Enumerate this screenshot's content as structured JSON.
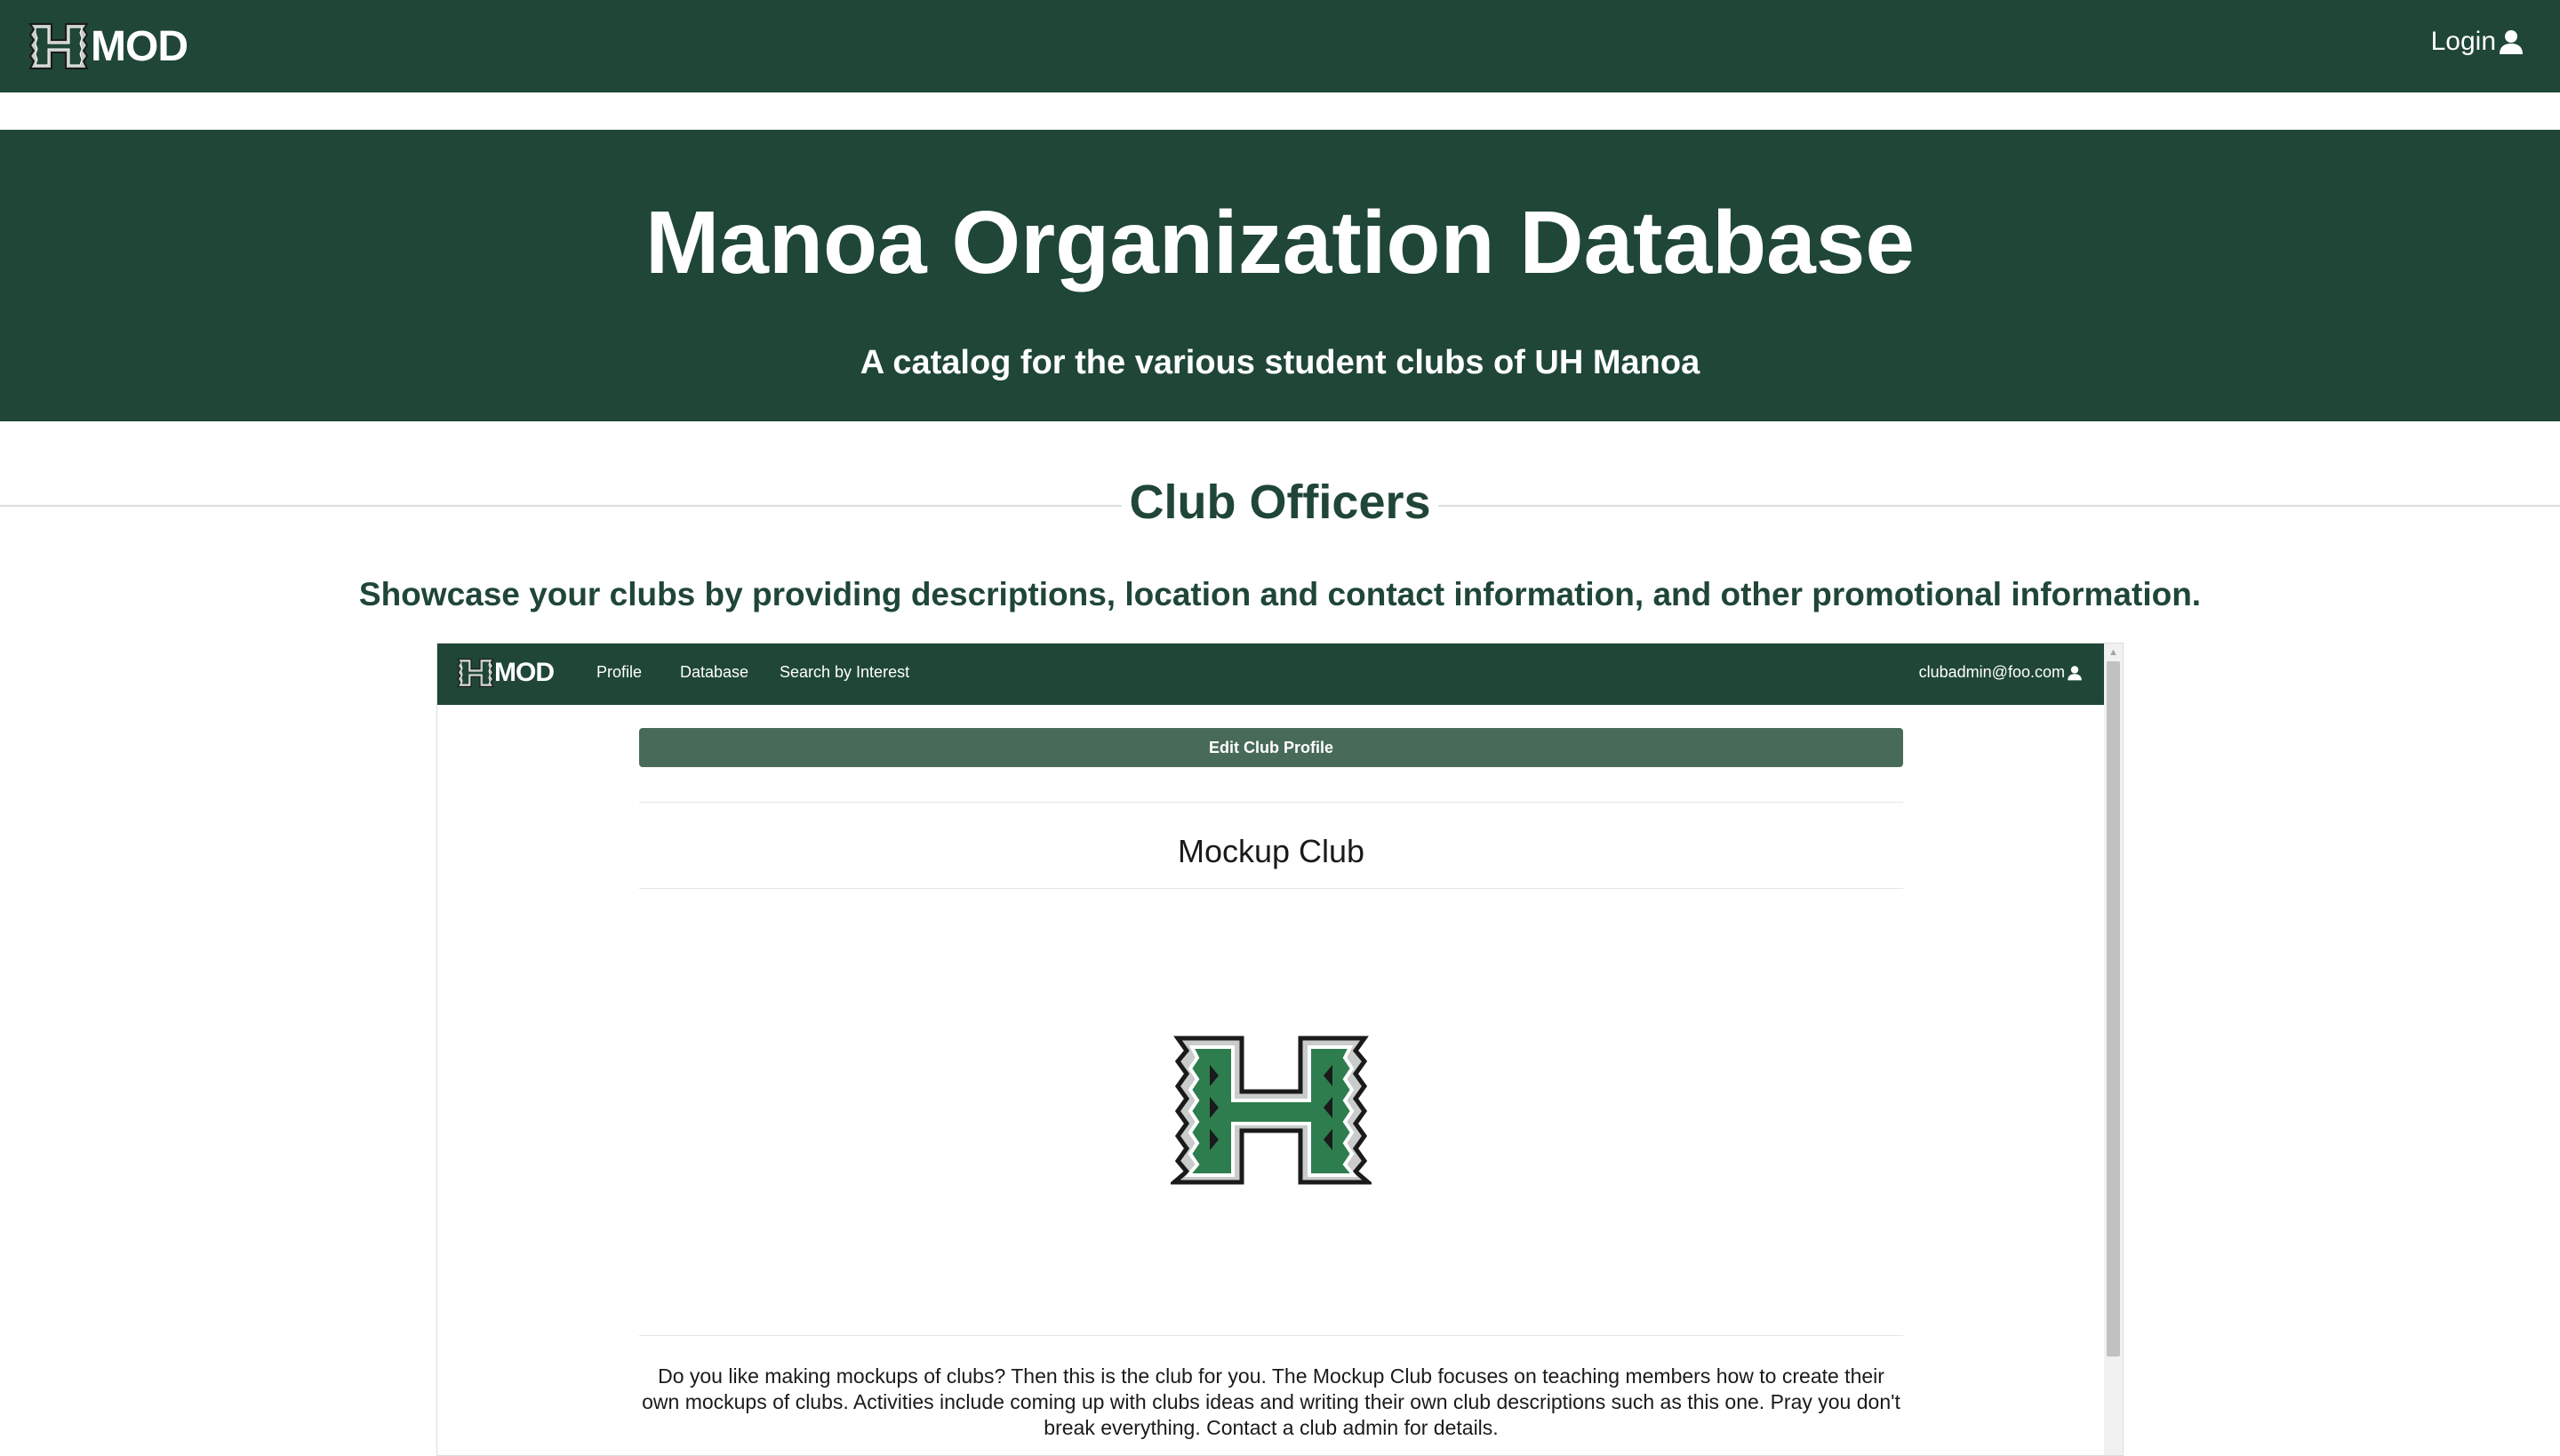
{
  "navbar": {
    "brand": "MOD",
    "login_label": "Login",
    "logo_icon": "uh-h-logo-icon",
    "user_icon": "user-icon"
  },
  "hero": {
    "title": "Manoa Organization Database",
    "subtitle": "A catalog for the various student clubs of UH Manoa"
  },
  "section": {
    "title": "Club Officers",
    "description": "Showcase your clubs by providing descriptions, location and contact information, and other promotional information."
  },
  "screenshot": {
    "navbar": {
      "brand": "MOD",
      "links": [
        "Profile",
        "Database",
        "Search by Interest"
      ],
      "user": "clubadmin@foo.com"
    },
    "edit_button": "Edit Club Profile",
    "club_name": "Mockup Club",
    "description": "Do you like making mockups of clubs? Then this is the club for you. The Mockup Club focuses on teaching members how to create their own mockups of clubs. Activities include coming up with clubs ideas and writing their own club descriptions such as this one. Pray you don't break everything. Contact a club admin for details."
  },
  "colors": {
    "primary": "#1f4636",
    "button": "#486b59",
    "logo_green": "#2e7d4f"
  }
}
